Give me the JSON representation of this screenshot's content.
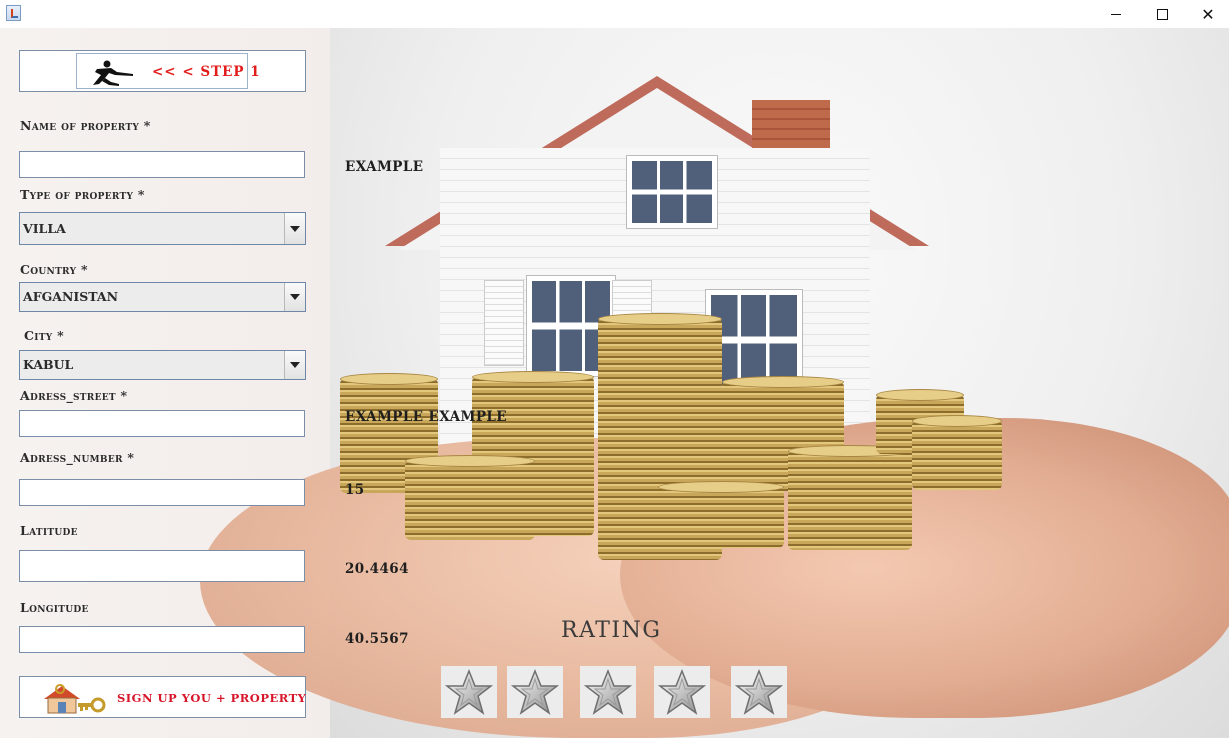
{
  "window": {
    "icon": "java-app-icon",
    "controls": [
      "minimize-icon",
      "maximize-icon",
      "close-icon"
    ],
    "close_glyph": "✕"
  },
  "step_button": {
    "label": "<< <  STEP 1",
    "icon": "runner-icon"
  },
  "form": {
    "name_label": "Name of property *",
    "name_value": "",
    "type_label": "Type of property *",
    "type_value": "VILLA",
    "country_label": "Country *",
    "country_value": "AFGANISTAN",
    "city_label": "City *",
    "city_value": "KABUL",
    "street_label": "Adress_street *",
    "street_value": "",
    "number_label": "Adress_number *",
    "number_value": "",
    "latitude_label": "Latitude",
    "latitude_value": "",
    "longitude_label": "Longitude",
    "longitude_value": ""
  },
  "preview": {
    "name": "EXAMPLE",
    "street": "EXAMPLE EXAMPLE",
    "number": "15",
    "latitude": "20.4464",
    "longitude": "40.5567"
  },
  "signup_button": {
    "label": "SIGN UP YOU + PROPERTY",
    "icon": "house-key-icon"
  },
  "rating": {
    "title": "RATING",
    "max_stars": 5,
    "selected": 0,
    "star_icon": "star-icon"
  }
}
